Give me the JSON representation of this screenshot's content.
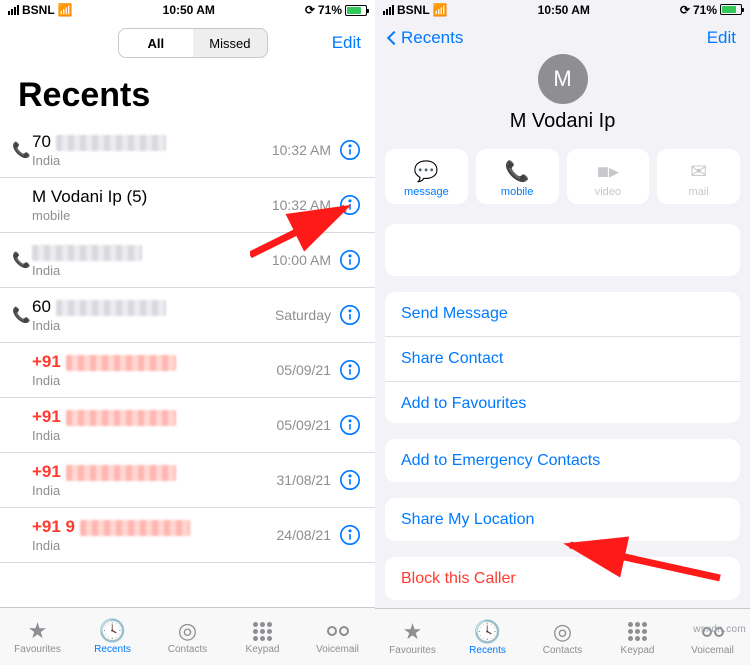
{
  "status": {
    "carrier": "BSNL",
    "time": "10:50 AM",
    "battery": "71%"
  },
  "left": {
    "seg_all": "All",
    "seg_missed": "Missed",
    "edit": "Edit",
    "title": "Recents",
    "rows": [
      {
        "name_prefix": "70",
        "sub": "India",
        "time": "10:32 AM",
        "missed": false,
        "out": true,
        "blur": "gray"
      },
      {
        "name_prefix": "M Vodani Ip (5)",
        "sub": "mobile",
        "time": "10:32 AM",
        "missed": false,
        "out": false,
        "blur": ""
      },
      {
        "name_prefix": "",
        "sub": "India",
        "time": "10:00 AM",
        "missed": false,
        "out": true,
        "blur": "gray"
      },
      {
        "name_prefix": "60",
        "sub": "India",
        "time": "Saturday",
        "missed": false,
        "out": true,
        "blur": "gray"
      },
      {
        "name_prefix": "+91",
        "sub": "India",
        "time": "05/09/21",
        "missed": true,
        "out": false,
        "blur": "red"
      },
      {
        "name_prefix": "+91",
        "sub": "India",
        "time": "05/09/21",
        "missed": true,
        "out": false,
        "blur": "red"
      },
      {
        "name_prefix": "+91",
        "sub": "India",
        "time": "31/08/21",
        "missed": true,
        "out": false,
        "blur": "red"
      },
      {
        "name_prefix": "+91 9",
        "sub": "India",
        "time": "24/08/21",
        "missed": true,
        "out": false,
        "blur": "red"
      }
    ]
  },
  "right": {
    "back": "Recents",
    "edit": "Edit",
    "avatar_letter": "M",
    "contact_name": "M Vodani Ip",
    "actions": {
      "message": "message",
      "mobile": "mobile",
      "video": "video",
      "mail": "mail"
    },
    "opts": {
      "send_message": "Send Message",
      "share_contact": "Share Contact",
      "add_fav": "Add to Favourites",
      "add_emergency": "Add to Emergency Contacts",
      "share_loc": "Share My Location",
      "block": "Block this Caller"
    }
  },
  "tabs": {
    "favourites": "Favourites",
    "recents": "Recents",
    "contacts": "Contacts",
    "keypad": "Keypad",
    "voicemail": "Voicemail"
  },
  "watermark": "wsxdn.com"
}
